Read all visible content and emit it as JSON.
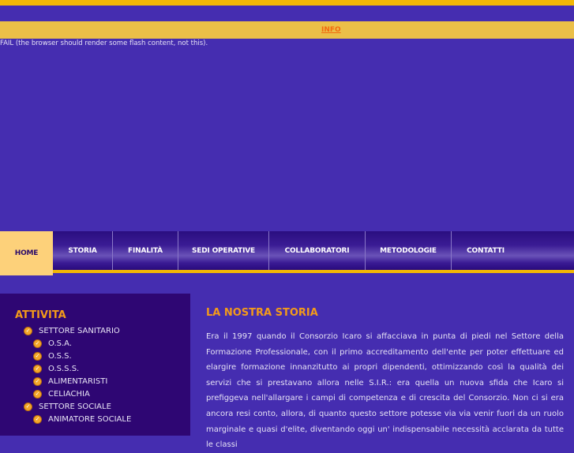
{
  "info_link": "INFO",
  "flash_fallback": "FAIL (the browser should render some flash content, not this).",
  "nav": [
    "HOME",
    "STORIA",
    "FINALITÀ",
    "SEDI OPERATIVE",
    "COLLABORATORI",
    "METODOLOGIE",
    "CONTATTI"
  ],
  "sidebar": {
    "title": "ATTIVITA",
    "items": [
      "SETTORE SANITARIO",
      "O.S.A.",
      "O.S.S.",
      "O.S.S.S.",
      "ALIMENTARISTI",
      "CELIACHIA",
      "SETTORE SOCIALE",
      "ANIMATORE SOCIALE"
    ]
  },
  "content": {
    "title": "LA NOSTRA STORIA",
    "body": "Era il 1997 quando il Consorzio Icaro si affacciava in punta di piedi nel Settore della Formazione Professionale, con il primo accreditamento dell'ente per poter effettuare ed elargire formazione innanzitutto ai propri dipendenti, ottimizzando così la qualità dei servizi che si prestavano allora nelle S.I.R.: era quella un nuova sfida che Icaro si prefiggeva nell'allargare i campi di competenza e di crescita del Consorzio. Non ci si era ancora resi conto, allora, di quanto questo settore potesse via via venir fuori da un ruolo marginale e quasi d'elite, diventando oggi un' indispensabile necessità acclarata da tutte le classi"
  }
}
